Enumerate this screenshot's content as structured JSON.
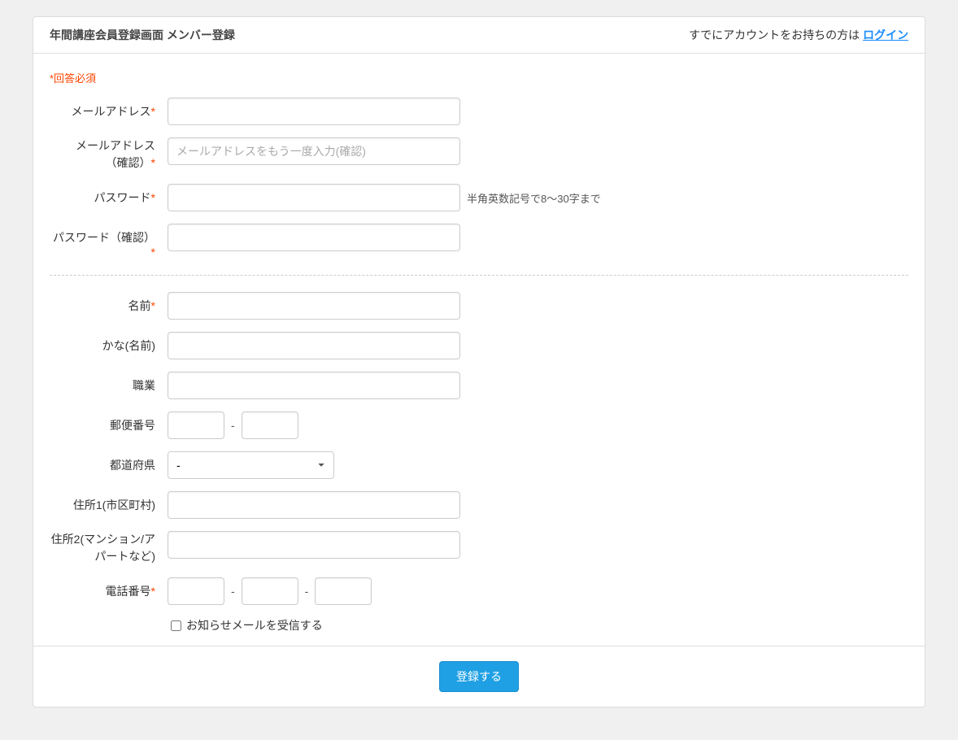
{
  "header": {
    "title": "年間講座会員登録画面 メンバー登録",
    "login_prompt": "すでにアカウントをお持ちの方は ",
    "login_link": "ログイン"
  },
  "required_note": "*回答必須",
  "labels": {
    "email": "メールアドレス",
    "email_confirm_line1": "メールアドレス",
    "email_confirm_line2": "（確認）",
    "password": "パスワード",
    "password_confirm": "パスワード（確認）",
    "name": "名前",
    "kana": "かな(名前)",
    "occupation": "職業",
    "postal": "郵便番号",
    "prefecture": "都道府県",
    "address1": "住所1(市区町村)",
    "address2_line1": "住所2(マンション/ア",
    "address2_line2": "パートなど)",
    "phone": "電話番号",
    "newsletter": "お知らせメールを受信する"
  },
  "placeholders": {
    "email_confirm": "メールアドレスをもう一度入力(確認)"
  },
  "help": {
    "password": "半角英数記号で8～30字まで"
  },
  "select": {
    "prefecture_default": "-"
  },
  "separators": {
    "dash": "-"
  },
  "submit_label": "登録する"
}
